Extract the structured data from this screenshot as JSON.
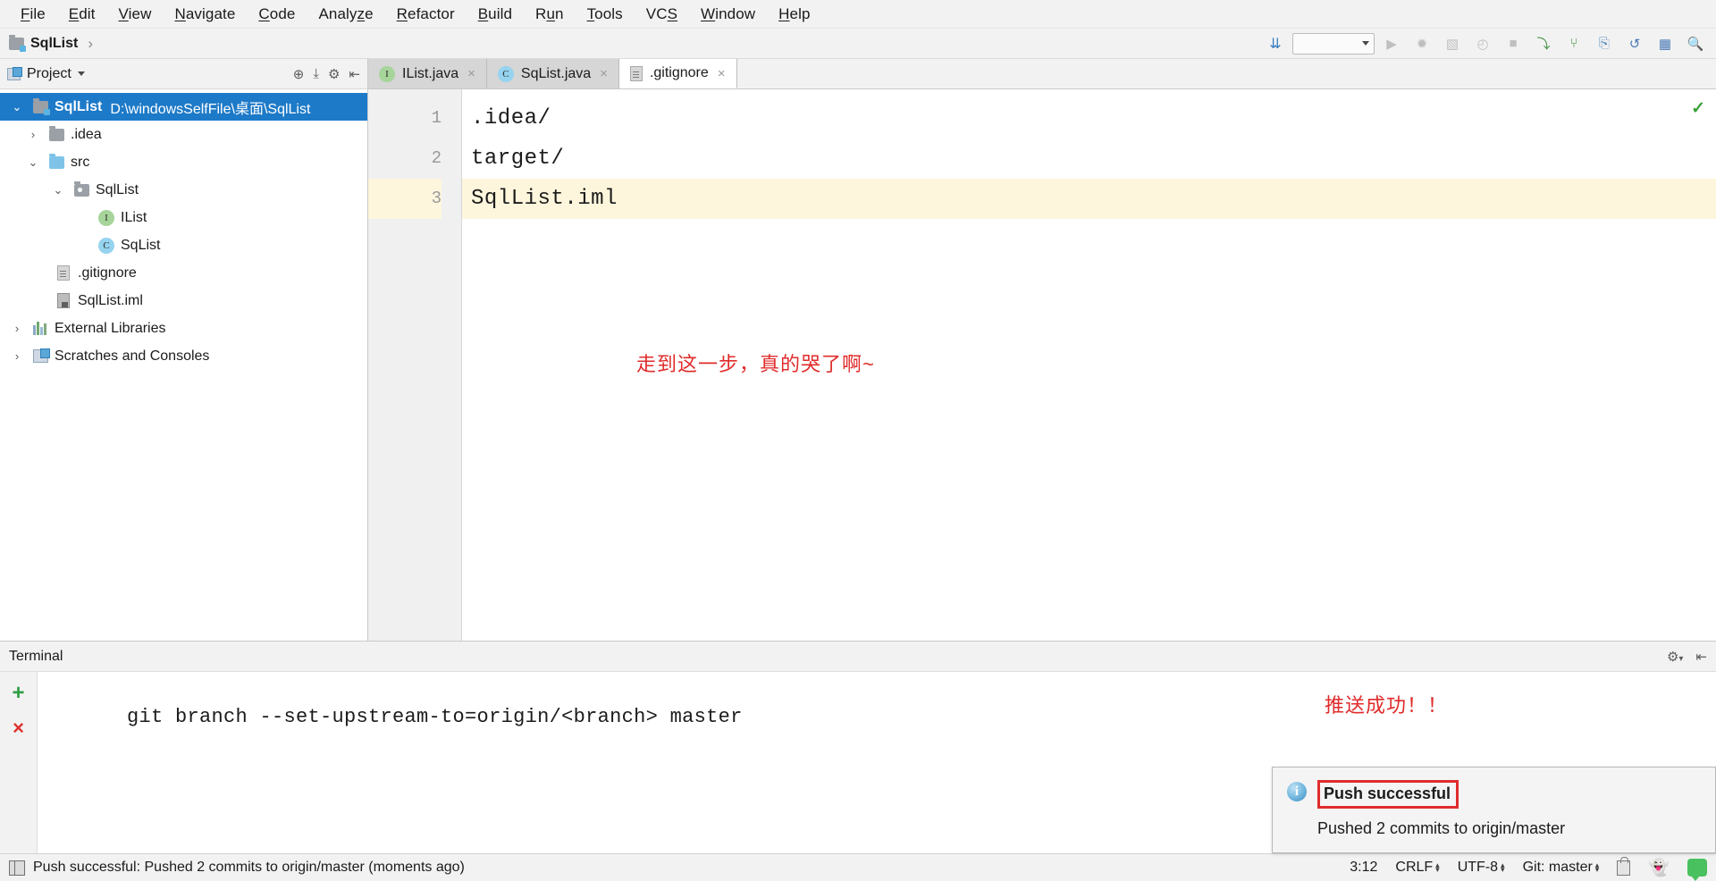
{
  "menubar": {
    "items": [
      {
        "label": "File",
        "mnemonic": "F"
      },
      {
        "label": "Edit",
        "mnemonic": "E"
      },
      {
        "label": "View",
        "mnemonic": "V"
      },
      {
        "label": "Navigate",
        "mnemonic": "N"
      },
      {
        "label": "Code",
        "mnemonic": "C"
      },
      {
        "label": "Analyze",
        "mnemonic": "z"
      },
      {
        "label": "Refactor",
        "mnemonic": "R"
      },
      {
        "label": "Build",
        "mnemonic": "B"
      },
      {
        "label": "Run",
        "mnemonic": "u"
      },
      {
        "label": "Tools",
        "mnemonic": "T"
      },
      {
        "label": "VCS",
        "mnemonic": "S"
      },
      {
        "label": "Window",
        "mnemonic": "W"
      },
      {
        "label": "Help",
        "mnemonic": "H"
      }
    ]
  },
  "navbar": {
    "breadcrumb_project": "SqlList",
    "breadcrumb_separator": "›",
    "run_config_value": "",
    "toolbar_icons": [
      "sort-alphabetically-icon",
      "run-icon",
      "debug-icon",
      "coverage-icon",
      "profiler-icon",
      "stop-icon",
      "update-project-icon",
      "commit-icon",
      "push-icon",
      "undo-icon",
      "layout-icon",
      "search-everywhere-icon"
    ]
  },
  "sidebar": {
    "title": "Project",
    "tools": [
      "locate-icon",
      "collapse-all-icon",
      "settings-icon",
      "hide-icon"
    ],
    "tree": [
      {
        "label": "SqlList",
        "sub": "D:\\windowsSelfFile\\桌面\\SqlList",
        "icon": "project-module-folder-icon",
        "arrow": "⌄",
        "selected": true,
        "depth": 0
      },
      {
        "label": ".idea",
        "sub": "",
        "icon": "folder-icon",
        "arrow": "›",
        "selected": false,
        "depth": 1
      },
      {
        "label": "src",
        "sub": "",
        "icon": "source-folder-icon",
        "arrow": "⌄",
        "selected": false,
        "depth": 1
      },
      {
        "label": "SqlList",
        "sub": "",
        "icon": "package-folder-icon",
        "arrow": "⌄",
        "selected": false,
        "depth": 2
      },
      {
        "label": "IList",
        "sub": "",
        "icon": "interface-icon",
        "arrow": "",
        "depth": 3,
        "glyph": "I"
      },
      {
        "label": "SqList",
        "sub": "",
        "icon": "class-icon",
        "arrow": "",
        "depth": 3,
        "glyph": "C"
      },
      {
        "label": ".gitignore",
        "sub": "",
        "icon": "file-icon",
        "arrow": "",
        "depth": 1.5
      },
      {
        "label": "SqlList.iml",
        "sub": "",
        "icon": "iml-file-icon",
        "arrow": "",
        "depth": 1.5
      },
      {
        "label": "External Libraries",
        "sub": "",
        "icon": "libraries-icon",
        "arrow": "›",
        "depth": 0.5
      },
      {
        "label": "Scratches and Consoles",
        "sub": "",
        "icon": "scratches-icon",
        "arrow": "›",
        "depth": 0.5
      }
    ]
  },
  "editor": {
    "tabs": [
      {
        "label": "IList.java",
        "icon": "interface-icon",
        "glyph": "I",
        "active": false
      },
      {
        "label": "SqList.java",
        "icon": "class-icon",
        "glyph": "C",
        "active": false
      },
      {
        "label": ".gitignore",
        "icon": "file-icon",
        "glyph": "",
        "active": true
      }
    ],
    "close_glyph": "×",
    "lines": [
      {
        "num": "1",
        "text": ".idea/",
        "highlighted": false
      },
      {
        "num": "2",
        "text": "target/",
        "highlighted": false
      },
      {
        "num": "3",
        "text": "SqlList.iml",
        "highlighted": true
      }
    ],
    "annotation_red": "走到这一步，真的哭了啊~",
    "inspection_ok_glyph": "✓"
  },
  "terminal": {
    "title": "Terminal",
    "add_glyph": "+",
    "close_glyph": "×",
    "settings_icon": "gear-icon",
    "hide_icon": "hide-icon",
    "command": "git branch --set-upstream-to=origin/<branch> master",
    "annotation_red": "推送成功！！"
  },
  "notification": {
    "icon": "info-icon",
    "icon_glyph": "i",
    "title": "Push successful",
    "message": "Pushed 2 commits to origin/master"
  },
  "statusbar": {
    "message": "Push successful: Pushed 2 commits to origin/master (moments ago)",
    "caret_position": "3:12",
    "line_separator": "CRLF",
    "encoding": "UTF-8",
    "branch": "Git: master",
    "right_icons": [
      "lock-icon",
      "ghost-icon",
      "feedback-icon"
    ]
  },
  "colors": {
    "accent_blue": "#1d7ac8",
    "annotation_red": "#e02b2b",
    "highlight_line": "#fdf6dd",
    "chrome_gray": "#f2f2f2"
  }
}
